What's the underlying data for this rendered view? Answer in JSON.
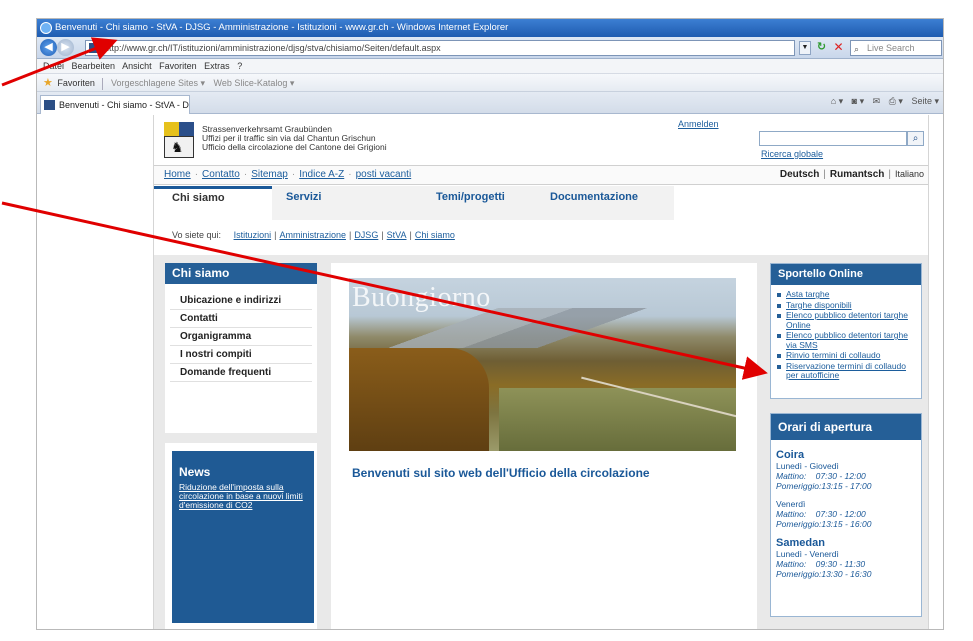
{
  "browser": {
    "title": "Benvenuti - Chi siamo - StVA - DJSG - Amministrazione - Istituzioni - www.gr.ch - Windows Internet Explorer",
    "url": "http://www.gr.ch/IT/istituzioni/amministrazione/djsg/stva/chisiamo/Seiten/default.aspx",
    "search_placeholder": "Live Search",
    "menu": [
      "Datei",
      "Bearbeiten",
      "Ansicht",
      "Favoriten",
      "Extras",
      "?"
    ],
    "favorites_label": "Favoriten",
    "suggested_sites": "Vorgeschlagene Sites ▾",
    "web_slice": "Web Slice-Katalog ▾",
    "tab_title": "Benvenuti - Chi siamo - StVA - DJSG - A...",
    "page_menu": "Seite ▾"
  },
  "site": {
    "agency_de": "Strassenverkehrsamt Graubünden",
    "agency_rm": "Uffizi per il traffic sin via dal Chantun Grischun",
    "agency_it": "Ufficio della circolazione del Cantone dei Grigioni",
    "login": "Anmelden",
    "global_search": "Ricerca globale"
  },
  "topnav": {
    "links": [
      "Home",
      "Contatto",
      "Sitemap",
      "Indice A-Z",
      "posti vacanti"
    ],
    "lang_de": "Deutsch",
    "lang_rm": "Rumantsch",
    "lang_it": "Italiano"
  },
  "tabs": [
    "Chi siamo",
    "Servizi",
    "Temi/progetti",
    "Documentazione"
  ],
  "breadcrumb": {
    "prefix": "Vo siete qui:",
    "items": [
      "Istituzioni",
      "Amministrazione",
      "DJSG",
      "StVA",
      "Chi siamo"
    ]
  },
  "left": {
    "title": "Chi siamo",
    "items": [
      "Ubicazione e indirizzi",
      "Contatti",
      "Organigramma",
      "I nostri compiti",
      "Domande frequenti"
    ]
  },
  "news": {
    "title": "News",
    "link": "Riduzione dell'imposta sulla circolazione in base a nuovi limiti d'emissione di CO2"
  },
  "center": {
    "hero_text": "Buongiorno",
    "welcome": "Benvenuti sul sito web dell'Ufficio della circolazione"
  },
  "sportello": {
    "title": "Sportello Online",
    "items": [
      "Asta targhe",
      "Targhe disponibili",
      "Elenco pubblico detentori targhe Online",
      "Elenco pubblico detentori targhe via SMS",
      "Rinvio termini di collaudo",
      "Riservazione termini di collaudo per autofficine"
    ]
  },
  "orari": {
    "title": "Orari di apertura",
    "coira": {
      "city": "Coira",
      "days1": "Lunedì - Giovedì",
      "morning1": "Mattino:    07:30 - 12:00",
      "afternoon1": "Pomeriggio:13:15 - 17:00",
      "days2": "Venerdì",
      "morning2": "Mattino:    07:30 - 12:00",
      "afternoon2": "Pomeriggio:13:15 - 16:00"
    },
    "samedan": {
      "city": "Samedan",
      "days": "Lunedì - Venerdì",
      "morning": "Mattino:    09:30 - 11:30",
      "afternoon": "Pomeriggio:13:30 - 16:30"
    }
  },
  "colors": {
    "brand_blue": "#255f97",
    "link_blue": "#1c5d9c",
    "arrow_red": "#e00000"
  }
}
